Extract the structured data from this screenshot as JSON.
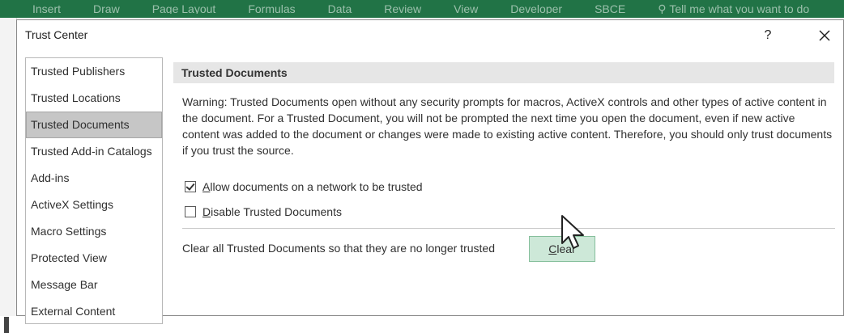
{
  "ribbon": {
    "tabs": [
      "Insert",
      "Draw",
      "Page Layout",
      "Formulas",
      "Data",
      "Review",
      "View",
      "Developer",
      "SBCE"
    ],
    "tell_me": "Tell me what you want to do"
  },
  "dialog": {
    "title": "Trust Center",
    "help_label": "?",
    "close_label": "✕"
  },
  "nav": {
    "items": [
      "Trusted Publishers",
      "Trusted Locations",
      "Trusted Documents",
      "Trusted Add-in Catalogs",
      "Add-ins",
      "ActiveX Settings",
      "Macro Settings",
      "Protected View",
      "Message Bar",
      "External Content"
    ],
    "selected_index": 2
  },
  "content": {
    "header": "Trusted Documents",
    "warning": "Warning: Trusted Documents open without any security prompts for macros, ActiveX controls and other types of active content in the document.  For a Trusted Document, you will not be prompted the next time you open the document, even if new active content was added to the document or changes were made to existing active content. Therefore, you should only trust documents if you trust the source.",
    "allow_network": {
      "hotkey": "A",
      "rest": "llow documents on a network to be trusted",
      "checked": true
    },
    "disable_trusted": {
      "hotkey": "D",
      "rest": "isable Trusted Documents",
      "checked": false
    },
    "clear_label": "Clear all Trusted Documents so that they are no longer trusted",
    "clear_button": {
      "hotkey": "C",
      "rest": "lear"
    }
  },
  "colors": {
    "ribbon": "#217346",
    "selected_nav": "#c6c6c6",
    "clear_button_bg": "#cde8d8",
    "section_header_bg": "#e6e6e6"
  }
}
